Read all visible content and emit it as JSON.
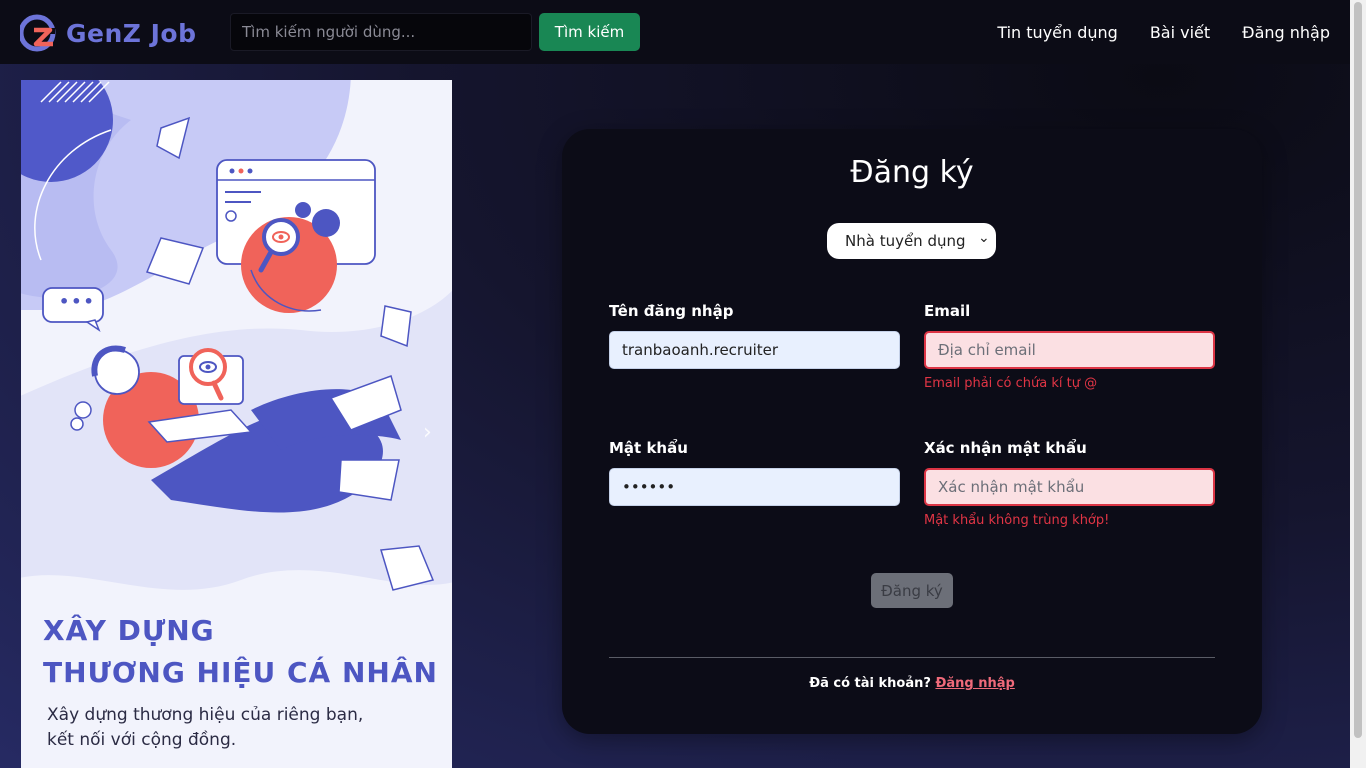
{
  "navbar": {
    "brand": "GenZ Job",
    "search_placeholder": "Tìm kiếm người dùng...",
    "search_button": "Tìm kiếm",
    "links": [
      "Tin tuyển dụng",
      "Bài viết",
      "Đăng nhập"
    ]
  },
  "hero": {
    "title_line1": "XÂY DỰNG",
    "title_line2": "THƯƠNG HIỆU CÁ NHÂN",
    "subtitle_line1": "Xây dựng thương hiệu của riêng bạn,",
    "subtitle_line2": "kết nối với cộng đồng.",
    "speech_bubble": "•••"
  },
  "form": {
    "title": "Đăng ký",
    "role_selected": "Nhà tuyển dụng",
    "username_label": "Tên đăng nhập",
    "username_value": "tranbaoanh.recruiter",
    "email_label": "Email",
    "email_placeholder": "Địa chỉ email",
    "email_error": "Email phải có chứa kí tự @",
    "password_label": "Mật khẩu",
    "password_value": "••••••",
    "confirm_label": "Xác nhận mật khẩu",
    "confirm_placeholder": "Xác nhận mật khẩu",
    "confirm_error": "Mật khẩu không trùng khớp!",
    "submit": "Đăng ký",
    "have_account": "Đã có tài khoản?",
    "login_link": "Đăng nhập"
  },
  "colors": {
    "brand": "#6d74d9",
    "search_button": "#198754",
    "error": "#dc3545",
    "hero_accent": "#4d56c2",
    "illustration_red": "#f0635a"
  }
}
